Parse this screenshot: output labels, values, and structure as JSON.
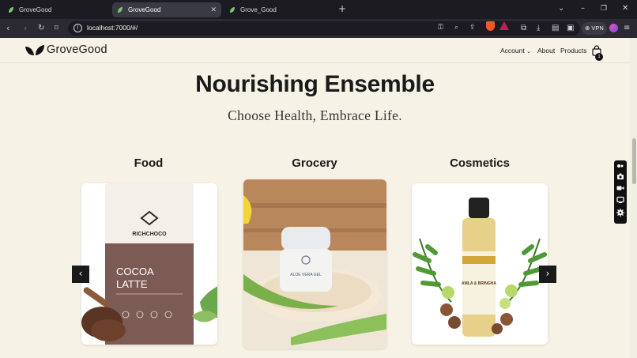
{
  "browser": {
    "tabs": [
      {
        "title": "GroveGood",
        "active": false
      },
      {
        "title": "GroveGood",
        "active": true
      },
      {
        "title": "Grove_Good",
        "active": false
      }
    ],
    "new_tab": "+",
    "url": "localhost:7000/#/",
    "vpn_label": "VPN"
  },
  "site": {
    "logo_text": "GroveGood",
    "nav": {
      "account": "Account",
      "about": "About",
      "products": "Products"
    },
    "cart_count": "1"
  },
  "hero": {
    "title": "Nourishing Ensemble",
    "subtitle": "Choose Health, Embrace Life."
  },
  "categories": [
    {
      "name": "Food",
      "image": "cocoa-latte-pouch"
    },
    {
      "name": "Grocery",
      "image": "aloe-gel-jar"
    },
    {
      "name": "Cosmetics",
      "image": "amla-oil-bottle"
    }
  ],
  "product_labels": {
    "food_brand": "RICHCHOCO",
    "food_line1": "COCOA",
    "food_line2": "LATTE",
    "grocery_jar": "ALOE VERA GEL",
    "cosmetics_bottle": "AMLA & BRINGHA"
  },
  "carousel": {
    "prev_icon": "chevron-left-icon",
    "next_icon": "chevron-right-icon"
  }
}
